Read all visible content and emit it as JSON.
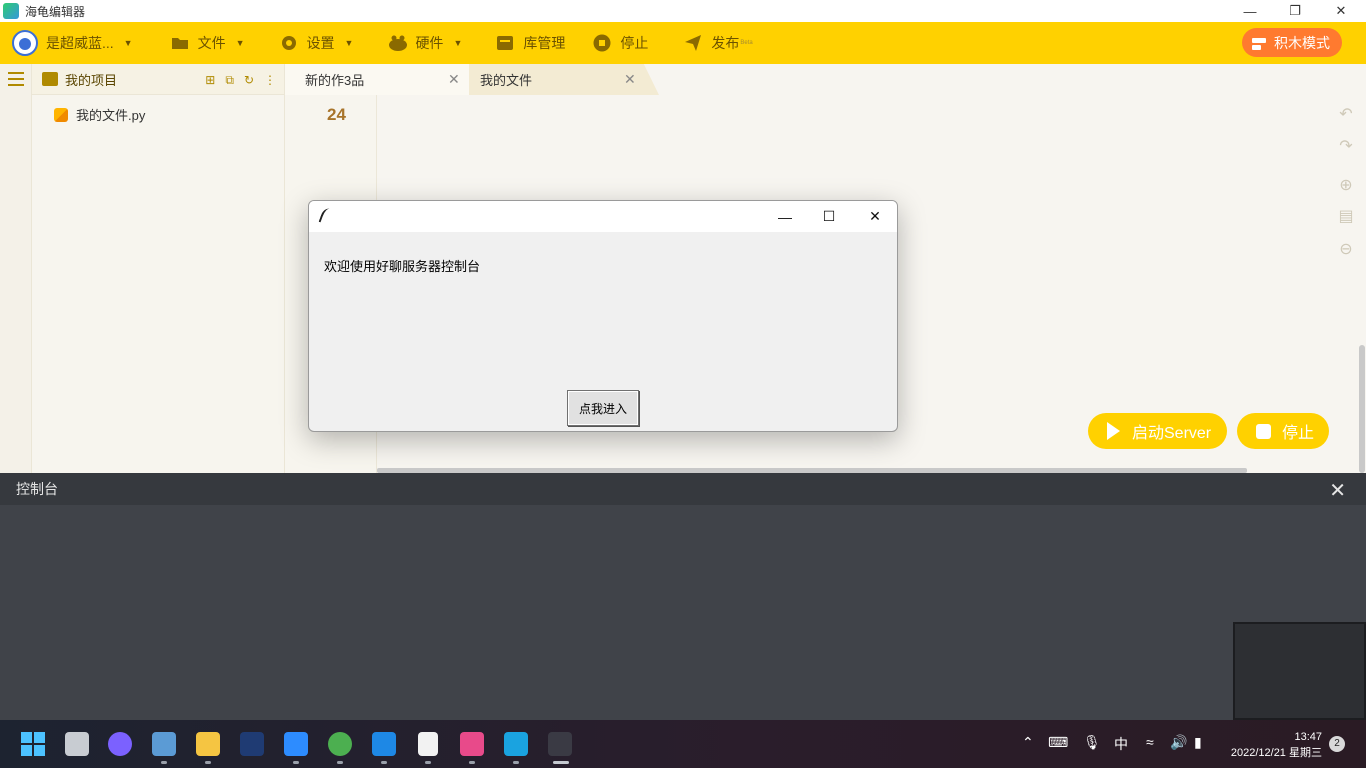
{
  "window": {
    "title": "海龟编辑器"
  },
  "menubar": {
    "user_name": "是超威蓝...",
    "items": [
      {
        "label": "文件",
        "icon": "folder-icon",
        "caret": true
      },
      {
        "label": "设置",
        "icon": "gear-icon",
        "caret": true
      },
      {
        "label": "硬件",
        "icon": "hardware-icon",
        "caret": true
      },
      {
        "label": "库管理",
        "icon": "library-icon",
        "caret": false
      },
      {
        "label": "停止",
        "icon": "stop-icon",
        "caret": false
      },
      {
        "label": "发布",
        "icon": "send-icon",
        "caret": false,
        "badge": "Beta"
      }
    ],
    "block_mode": "积木模式",
    "accent": "#ffd100",
    "block_mode_color": "#ff7a2f"
  },
  "project": {
    "title": "我的项目",
    "files": [
      "我的文件.py"
    ]
  },
  "tabs": [
    {
      "label": "新的作3品",
      "active": true
    },
    {
      "label": "我的文件",
      "active": false
    }
  ],
  "editor": {
    "line_number": "24"
  },
  "run": {
    "start_label": "启动Server",
    "stop_label": "停止"
  },
  "console": {
    "title": "控制台"
  },
  "dialog": {
    "message": "欢迎使用好聊服务器控制台",
    "button": "点我进入"
  },
  "taskbar": {
    "time": "13:47",
    "date": "2022/12/21 星期三",
    "ime": "中",
    "notifications": "2"
  }
}
